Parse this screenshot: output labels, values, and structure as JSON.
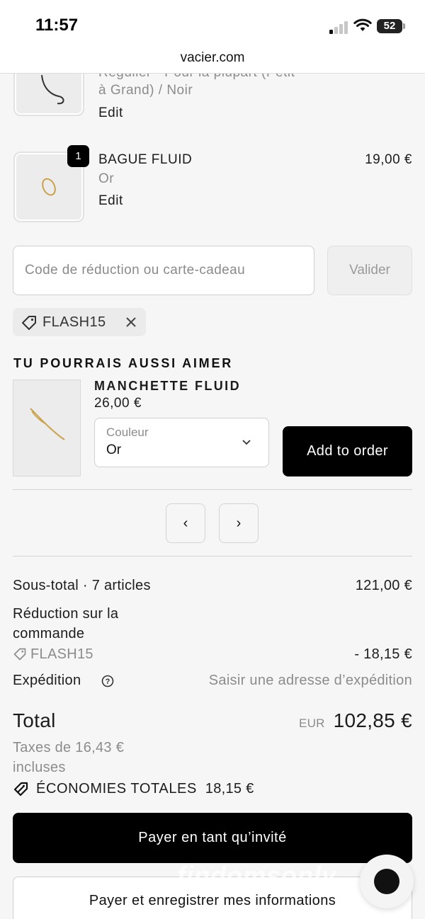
{
  "status_bar": {
    "time": "11:57",
    "battery": "52"
  },
  "browser": {
    "url": "vacier.com"
  },
  "cart": {
    "items": [
      {
        "variant_line1": "Régulier - Pour la plupart (Petit",
        "variant_line2": "à Grand) / Noir",
        "edit_label": "Edit"
      },
      {
        "name": "BAGUE FLUID",
        "variant": "Or",
        "price": "19,00 €",
        "quantity": "1",
        "edit_label": "Edit"
      }
    ]
  },
  "discount": {
    "placeholder": "Code de réduction ou carte-cadeau",
    "apply_label": "Valider",
    "applied_code": "FLASH15"
  },
  "recommendations": {
    "heading": "TU POURRAIS AUSSI AIMER",
    "product": {
      "name": "MANCHETTE FLUID",
      "price": "26,00 €",
      "color_label": "Couleur",
      "color_value": "Or",
      "add_label": "Add to order"
    },
    "prev_label": "‹",
    "next_label": "›"
  },
  "summary": {
    "subtotal_label": "Sous-total · 7 articles",
    "subtotal_value": "121,00 €",
    "order_discount_line1": "Réduction sur la",
    "order_discount_line2": "commande",
    "discount_code": "FLASH15",
    "discount_value": "- 18,15 €",
    "shipping_label": "Expédition",
    "shipping_value": "Saisir une adresse d’expédition",
    "total_label": "Total",
    "currency": "EUR",
    "total_value": "102,85 €",
    "taxes_line1": "Taxes de 16,43 €",
    "taxes_line2": "incluses",
    "savings_label": "ÉCONOMIES TOTALES",
    "savings_value": "18,15 €"
  },
  "actions": {
    "guest_checkout_label": "Payer en tant qu’invité",
    "save_info_label": "Payer et enregistrer mes informations"
  },
  "watermark": {
    "text": "findomsonly"
  }
}
